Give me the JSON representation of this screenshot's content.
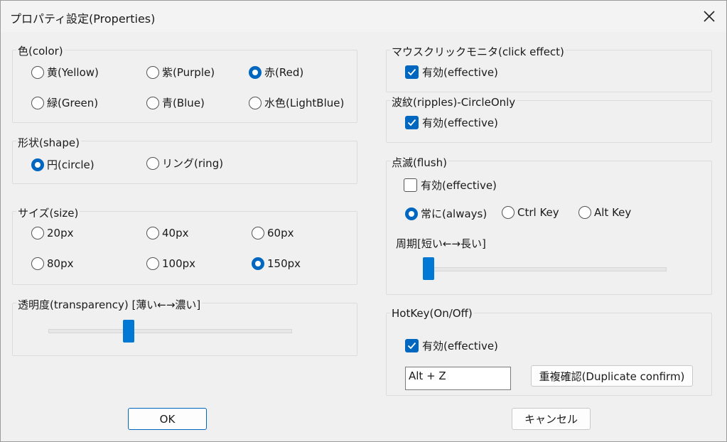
{
  "window": {
    "title": "プロパティ設定(Properties)"
  },
  "color": {
    "label": "色(color)",
    "options": [
      "黄(Yellow)",
      "紫(Purple)",
      "赤(Red)",
      "緑(Green)",
      "青(Blue)",
      "水色(LightBlue)"
    ],
    "selected": "赤(Red)"
  },
  "shape": {
    "label": "形状(shape)",
    "options": [
      "円(circle)",
      "リング(ring)"
    ],
    "selected": "円(circle)"
  },
  "size": {
    "label": "サイズ(size)",
    "options": [
      "20px",
      "40px",
      "60px",
      "80px",
      "100px",
      "150px"
    ],
    "selected": "150px"
  },
  "transparency": {
    "label": "透明度(transparency) [薄い←→濃い]",
    "level": 0.32
  },
  "click_effect": {
    "label": "マウスクリックモニタ(click effect)",
    "checkbox_label": "有効(effective)",
    "checked": true
  },
  "ripples": {
    "label": "波紋(ripples)-CircleOnly",
    "checkbox_label": "有効(effective)",
    "checked": true
  },
  "flush": {
    "label": "点滅(flush)",
    "checkbox_label": "有効(effective)",
    "checked": false,
    "modes": [
      "常に(always)",
      "Ctrl Key",
      "Alt Key"
    ],
    "selected_mode": "常に(always)",
    "period_label": "周期[短い←→長い]",
    "period_level": 0.0
  },
  "hotkey": {
    "label": "HotKey(On/Off)",
    "checkbox_label": "有効(effective)",
    "checked": true,
    "value": "Alt + Z",
    "duplicate_button": "重複確認(Duplicate confirm)"
  },
  "buttons": {
    "ok": "OK",
    "cancel": "キャンセル"
  },
  "icons": {
    "close": "close-icon",
    "check": "checkmark-icon"
  },
  "colors": {
    "accent": "#0067c0",
    "slider": "#0078d4"
  }
}
